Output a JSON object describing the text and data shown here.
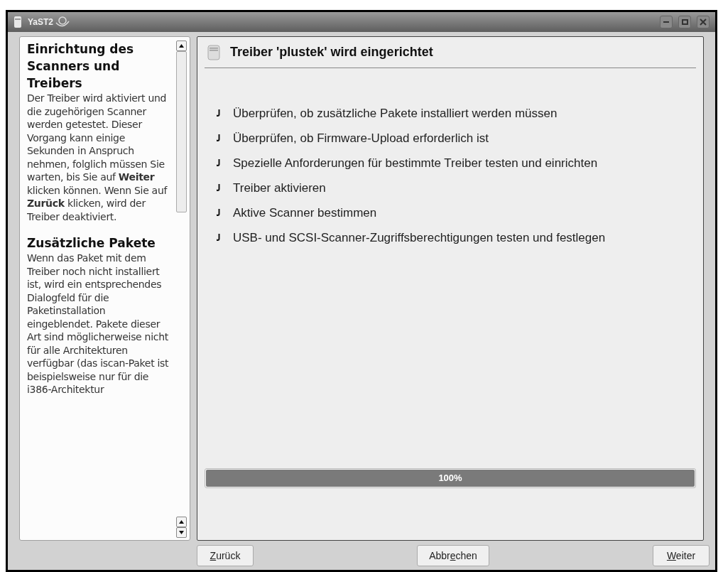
{
  "window": {
    "title": "YaST2"
  },
  "help": {
    "sections": [
      {
        "heading": "Einrichtung des Scanners und Treibers",
        "text": "Der Treiber wird aktiviert und die zugehörigen Scanner werden getestet. Dieser Vorgang kann einige Sekunden in Anspruch nehmen, folglich müssen Sie warten, bis Sie auf **Weiter** klicken können. Wenn Sie auf **Zurück** klicken, wird der Treiber deaktiviert."
      },
      {
        "heading": "Zusätzliche Pakete",
        "text": "Wenn das Paket mit dem Treiber noch nicht installiert ist, wird ein entsprechendes Dialogfeld für die Paketinstallation eingeblendet. Pakete dieser Art sind möglicherweise nicht für alle Architekturen verfügbar (das iscan-Paket ist beispielsweise nur für die i386-Architektur"
      }
    ]
  },
  "panel": {
    "title": "Treiber 'plustek' wird eingerichtet",
    "steps": [
      {
        "label": "Überprüfen, ob zusätzliche Pakete installiert werden müssen",
        "done": true
      },
      {
        "label": "Überprüfen, ob Firmware-Upload erforderlich ist",
        "done": true
      },
      {
        "label": "Spezielle Anforderungen für bestimmte Treiber testen und einrichten",
        "done": true
      },
      {
        "label": "Treiber aktivieren",
        "done": true
      },
      {
        "label": "Aktive Scanner bestimmen",
        "done": true
      },
      {
        "label": "USB- und SCSI-Scanner-Zugriffsberechtigungen testen und festlegen",
        "done": true
      }
    ],
    "progress": {
      "level": 1,
      "label": "100%"
    }
  },
  "buttons": [
    {
      "key": "Z",
      "post": "urück"
    },
    {
      "pre": "Abbr",
      "key": "e",
      "post": "chen"
    },
    {
      "key": "W",
      "post": "eiter"
    }
  ]
}
